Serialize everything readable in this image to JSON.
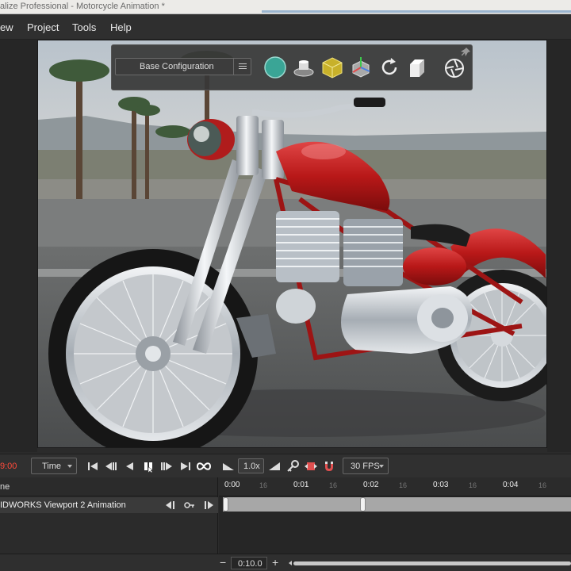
{
  "window": {
    "title": "alize Professional - Motorcycle Animation *"
  },
  "menu": {
    "items": [
      "ew",
      "Project",
      "Tools",
      "Help"
    ]
  },
  "toolbar": {
    "configuration": "Base Configuration",
    "icons": [
      "appearance-sphere-icon",
      "scene-turntable-icon",
      "model-cube-icon",
      "camera-gizmo-icon",
      "reload-icon",
      "decal-box-icon",
      "render-aperture-icon",
      "pin-icon"
    ]
  },
  "timeline": {
    "current_time": "9:00",
    "time_mode": "Time",
    "speed": "1.0x",
    "fps": "30 FPS",
    "track_header": "ne",
    "track_label": "IDWORKS Viewport 2 Animation",
    "ruler_major": [
      "0:00",
      "0:01",
      "0:02",
      "0:03",
      "0:04"
    ],
    "ruler_minor": "16",
    "zoom_value": "0:10.0",
    "keyframes_seconds": [
      0,
      2
    ],
    "playhead_seconds": 0
  },
  "colors": {
    "timecode": "#ff4a3a",
    "accent": "#4a7fb6",
    "body_red": "#c01818",
    "chrome": "#d8dde2"
  }
}
